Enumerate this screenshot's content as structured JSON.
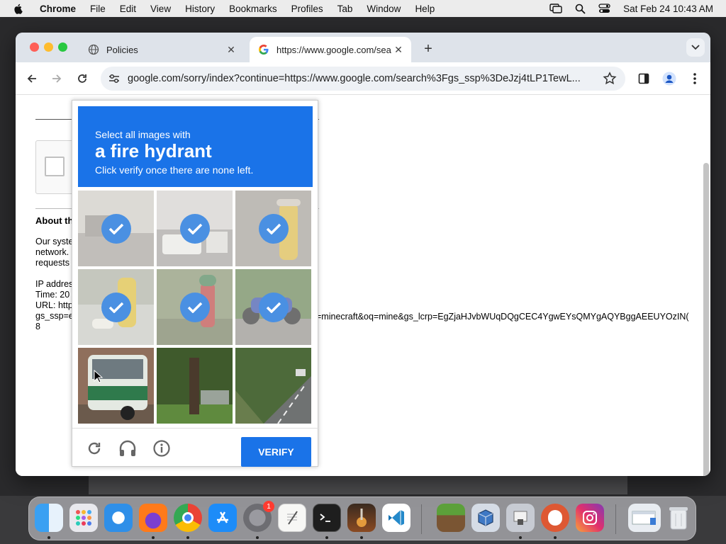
{
  "menubar": {
    "app_name": "Chrome",
    "items": [
      "File",
      "Edit",
      "View",
      "History",
      "Bookmarks",
      "Profiles",
      "Tab",
      "Window",
      "Help"
    ],
    "clock": "Sat Feb 24  10:43 AM"
  },
  "browser": {
    "tabs": [
      {
        "label": "Policies",
        "active": false
      },
      {
        "label": "https://www.google.com/sear",
        "active": true
      }
    ],
    "url": "google.com/sorry/index?continue=https://www.google.com/search%3Fgs_ssp%3DeJzj4tLP1TewL..."
  },
  "page": {
    "about_heading": "About th",
    "body_lines": [
      "Our syste",
      "network.",
      "requests"
    ],
    "info_lines": [
      "IP addres",
      "Time: 20",
      "URL: http",
      "gs_ssp=e",
      "8"
    ],
    "long_url_fragment": "=minecraft&oq=mine&gs_lcrp=EgZjaHJvbWUqDQgCEC4YgwEYsQMYgAQYBggAEEUYOzIN("
  },
  "captcha": {
    "line1": "Select all images with",
    "target": "a fire hydrant",
    "line3": "Click verify once there are none left.",
    "verify_label": "VERIFY",
    "tiles_selected": [
      true,
      true,
      true,
      true,
      true,
      true,
      false,
      false,
      false
    ]
  },
  "dock": {
    "apps": [
      "finder",
      "launchpad",
      "safari",
      "firefox",
      "chrome",
      "app-store",
      "system-settings",
      "textedit",
      "terminal",
      "garageband",
      "vscode",
      "minecraft",
      "virtualbox",
      "preview",
      "duckduckgo",
      "instagram",
      "screenshot",
      "trash"
    ],
    "settings_badge": "1"
  },
  "colors": {
    "captcha_blue": "#1a73e8",
    "check_blue": "#4a90e2"
  }
}
